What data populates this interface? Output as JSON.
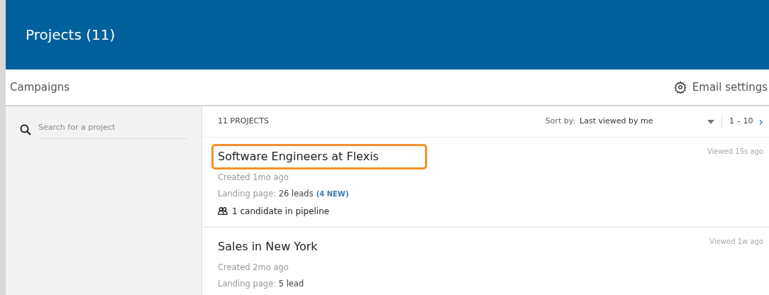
{
  "header": {
    "title": "Projects (11)"
  },
  "subheader": {
    "title": "Campaigns",
    "settings_label": "Email settings"
  },
  "search": {
    "placeholder": "Search for a project"
  },
  "toolbar": {
    "count": "11 PROJECTS",
    "sort_label": "Sort by:",
    "sort_value": "Last viewed by me",
    "range": "1 – 10",
    "next": "›"
  },
  "projects": [
    {
      "title": "Software Engineers at Flexis",
      "highlighted": true,
      "created": "Created 1mo ago",
      "landing": "Landing page: **26 leads**",
      "new_badge": "(4 NEW)",
      "pipeline": "1 candidate in pipeline",
      "viewed": "Viewed 15s ago"
    },
    {
      "title": "Sales in New York",
      "highlighted": false,
      "created": "Created 2mo ago",
      "landing": "Landing page: **5 lead**",
      "viewed": "Viewed 1w ago"
    }
  ]
}
